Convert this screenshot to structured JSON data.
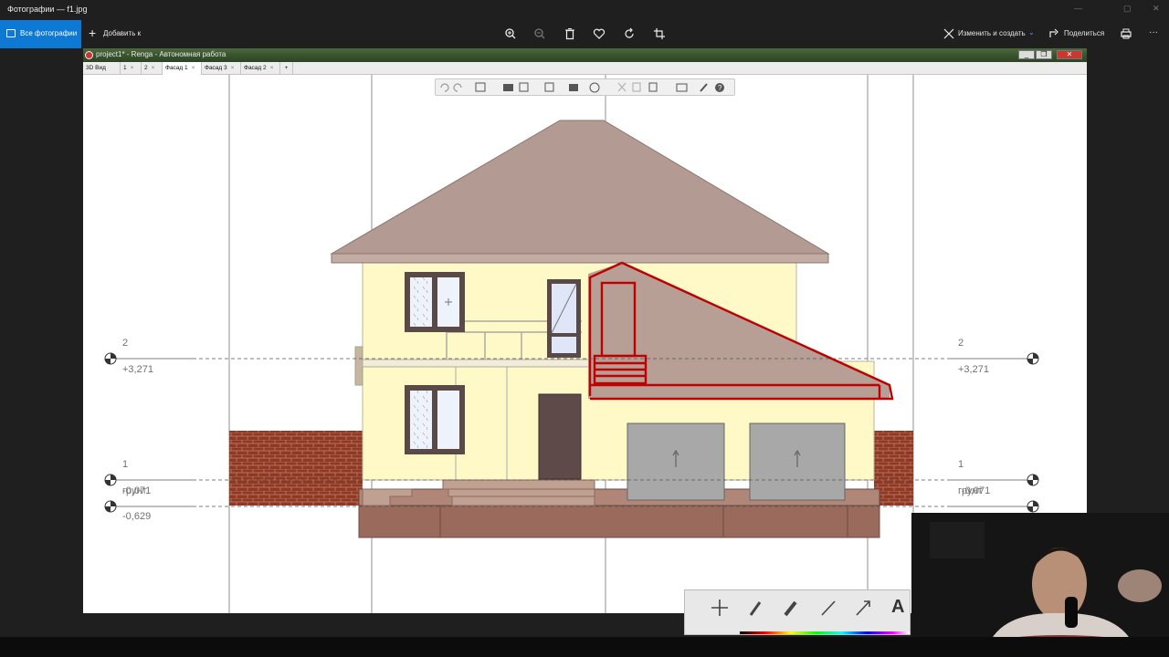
{
  "window": {
    "title": "Фотографии — f1.jpg"
  },
  "commandbar": {
    "all_photos": "Все фотографии",
    "add_to": "Добавить к",
    "edit_create": "Изменить и создать",
    "share": "Поделиться",
    "more": "···",
    "tools": [
      "zoom-in-icon",
      "zoom-out-icon",
      "delete-icon",
      "favorite-icon",
      "rotate-icon",
      "crop-icon",
      "print-icon"
    ]
  },
  "renga": {
    "title": "project1* - Renga - Автономная работа",
    "tabs": [
      {
        "label": "3D Вид",
        "active": false
      },
      {
        "label": "1",
        "active": false
      },
      {
        "label": "2",
        "active": false
      },
      {
        "label": "Фасад 1",
        "active": true
      },
      {
        "label": "Фасад 3",
        "active": false
      },
      {
        "label": "Фасад 2",
        "active": false
      }
    ],
    "tab_add": "+",
    "tab_close": "×"
  },
  "levels": {
    "left": [
      {
        "name": "2",
        "value": "+3,271"
      },
      {
        "name": "1",
        "value": "-0,071"
      },
      {
        "name": "грунт",
        "value": "-0,629"
      }
    ],
    "right": [
      {
        "name": "2",
        "value": "+3,271"
      },
      {
        "name": "1",
        "value": "-0,071"
      },
      {
        "name": "грунт",
        "value": ""
      }
    ]
  },
  "ink_toolbar": {
    "tools": [
      "move-icon",
      "pen-icon",
      "highlighter-icon",
      "line-icon",
      "arrow-icon",
      "text-icon"
    ],
    "text_tool_label": "A"
  },
  "colors": {
    "accent": "#0e78d5",
    "roof": "#b39a92",
    "wall": "#fff9c8",
    "brick": "#8a3b28",
    "foundation": "#9a6a5c",
    "sketch": "#c00000"
  }
}
